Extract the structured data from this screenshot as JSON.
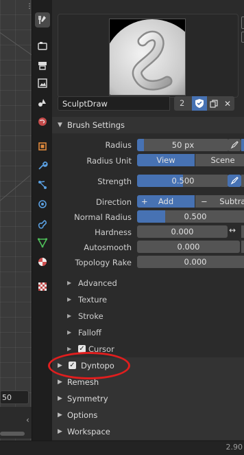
{
  "brush": {
    "name": "SculptDraw",
    "user_count": "2"
  },
  "brush_settings": {
    "title": "Brush Settings",
    "radius": {
      "label": "Radius",
      "value": "50 px",
      "fill_fraction": 0.04
    },
    "radius_unit": {
      "label": "Radius Unit",
      "options": [
        "View",
        "Scene"
      ],
      "selected": "View"
    },
    "strength": {
      "label": "Strength",
      "value": "0.500",
      "fill_fraction": 0.5
    },
    "direction": {
      "label": "Direction",
      "add": "Add",
      "subtract": "Subtract",
      "add_symbol": "+",
      "subtract_symbol": "−",
      "selected": "Add"
    },
    "normal_radius": {
      "label": "Normal Radius",
      "value": "0.500",
      "fill_fraction": 0.3
    },
    "hardness": {
      "label": "Hardness",
      "value": "0.000"
    },
    "autosmooth": {
      "label": "Autosmooth",
      "value": "0.000"
    },
    "topology_rake": {
      "label": "Topology Rake",
      "value": "0.000"
    }
  },
  "subpanels": [
    {
      "label": "Advanced"
    },
    {
      "label": "Texture"
    },
    {
      "label": "Stroke"
    },
    {
      "label": "Falloff"
    },
    {
      "label": "Cursor",
      "checkbox": true,
      "checked": true
    }
  ],
  "sections": [
    {
      "label": "Dyntopo",
      "checkbox": true,
      "checked": true
    },
    {
      "label": "Remesh"
    },
    {
      "label": "Symmetry"
    },
    {
      "label": "Options"
    },
    {
      "label": "Workspace"
    }
  ],
  "viewport": {
    "field_value": "50"
  },
  "status_bar": {
    "version": "2.90"
  },
  "colors": {
    "accent": "#4772b3",
    "annotation": "#e01e1e",
    "panel_bg": "#2b2b2b"
  },
  "tabs": [
    {
      "icon": "tool-icon",
      "active": true
    },
    {
      "icon": "render-icon"
    },
    {
      "icon": "output-icon"
    },
    {
      "icon": "view-layer-icon"
    },
    {
      "icon": "scene-icon"
    },
    {
      "icon": "world-icon"
    },
    {
      "icon": "object-icon"
    },
    {
      "icon": "modifier-icon"
    },
    {
      "icon": "particles-icon"
    },
    {
      "icon": "physics-icon"
    },
    {
      "icon": "constraints-icon"
    },
    {
      "icon": "data-icon"
    },
    {
      "icon": "material-icon"
    },
    {
      "icon": "texture-icon"
    }
  ]
}
